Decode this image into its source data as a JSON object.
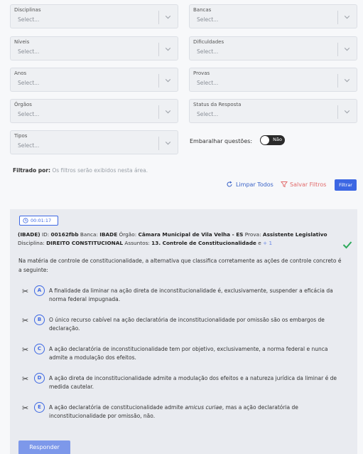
{
  "filters": [
    {
      "label": "Disciplinas",
      "placeholder": "Select..."
    },
    {
      "label": "Bancas",
      "placeholder": "Select..."
    },
    {
      "label": "Níveis",
      "placeholder": "Select..."
    },
    {
      "label": "Dificuldades",
      "placeholder": "Select..."
    },
    {
      "label": "Anos",
      "placeholder": "Select..."
    },
    {
      "label": "Provas",
      "placeholder": "Select..."
    },
    {
      "label": "Órgãos",
      "placeholder": "Select..."
    },
    {
      "label": "Status da Resposta",
      "placeholder": "Select..."
    },
    {
      "label": "Tipos",
      "placeholder": "Select..."
    }
  ],
  "shuffle": {
    "label": "Embaralhar questões:",
    "toggle_text": "Não"
  },
  "filtered": {
    "label": "Filtrado por:",
    "hint": "Os filtros serão exibidos nesta área."
  },
  "actions": {
    "clear": "Limpar Todos",
    "save": "Salvar Filtros",
    "filter": "Filtrar"
  },
  "question": {
    "timer": "00:01:17",
    "meta": {
      "banca_prefix": "(IBADE)",
      "id_label": "ID:",
      "id": "00162fbb",
      "banca_label": "Banca:",
      "banca": "IBADE",
      "orgao_label": "Órgão:",
      "orgao": "Câmara Municipal de Vila Velha - ES",
      "prova_label": "Prova:",
      "prova": "Assistente Legislativo",
      "disciplina_label": "Disciplina:",
      "disciplina": "DIREITO CONSTITUCIONAL",
      "assuntos_label": "Assuntos:",
      "assuntos": "13. Controle de Constitucionalidade",
      "extra_connector": "e",
      "extra": "+ 1"
    },
    "statement": "Na matéria de controle de constitucionalidade, a alternativa que classifica corretamente as ações de controle concreto é a seguinte:",
    "alternatives": [
      {
        "letter": "A",
        "text": "A finalidade da liminar na ação direta de inconstitucionalidade é, exclusivamente, suspender a eficácia da norma federal impugnada."
      },
      {
        "letter": "B",
        "text": "O único recurso cabível na ação declaratória de inconstitucionalidade por omissão são os embargos de declaração."
      },
      {
        "letter": "C",
        "text": "A ação declaratória de inconstitucionalidade tem por objetivo, exclusivamente, a norma federal e nunca admite a modulação dos efeitos."
      },
      {
        "letter": "D",
        "text": "A ação direta de inconstitucionalidade admite a modulação dos efeitos e a natureza jurídica da liminar é de medida cautelar."
      },
      {
        "letter": "E",
        "text_before": "A ação declaratória de constitucionalidade admite",
        "text_italic": "amicus curiae",
        "text_after": ", mas a ação declaratória de inconstitucionalidade por omissão, não."
      }
    ],
    "answer_button": "Responder"
  },
  "colors": {
    "accent": "#3c67e3",
    "danger": "#e26a6a",
    "success": "#2eaa5c",
    "card_bg": "#e9ebf0"
  }
}
